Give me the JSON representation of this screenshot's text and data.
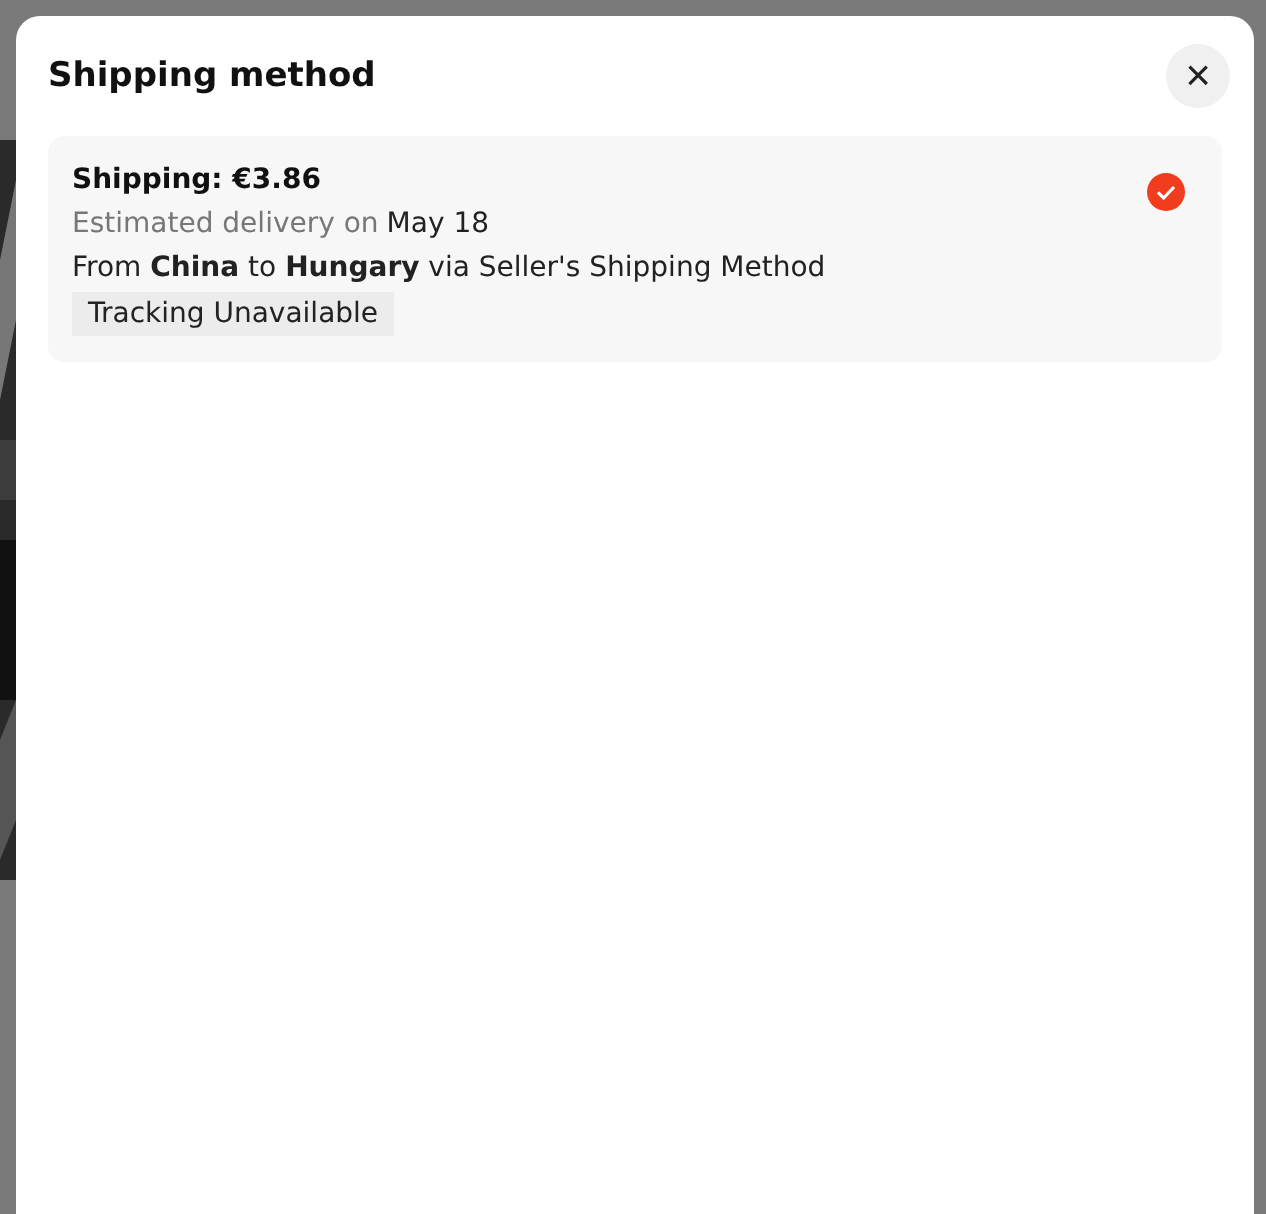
{
  "dialog": {
    "title": "Shipping method",
    "close": "×"
  },
  "options": [
    {
      "price": "Shipping: €3.86",
      "delivery_label": "Estimated delivery on",
      "delivery_date": "May 18",
      "route": "From **China** to **Hungary** via Seller's Shipping Method",
      "tag": "Tracking Unavailable",
      "selected": true
    }
  ]
}
